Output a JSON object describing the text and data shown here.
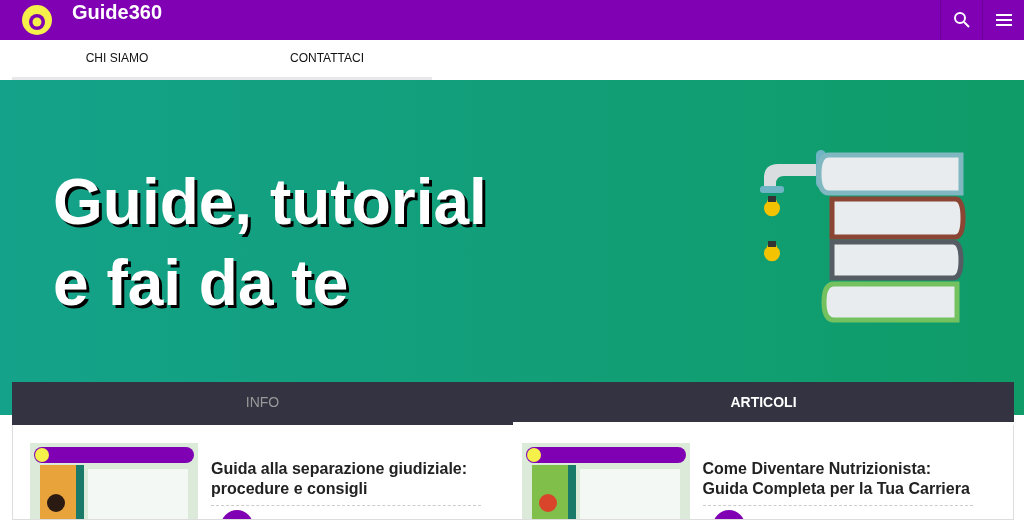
{
  "header": {
    "title": "Guide360"
  },
  "nav": {
    "items": [
      {
        "label": "CHI SIAMO"
      },
      {
        "label": "CONTATTACI"
      }
    ]
  },
  "hero": {
    "lines": [
      "Guide, tutorial",
      "e fai da te"
    ]
  },
  "tabs": [
    {
      "label": "INFO",
      "selected": false
    },
    {
      "label": "ARTICOLI",
      "selected": true
    }
  ],
  "articles": [
    {
      "title": "Guida alla separazione giudiziale: procedure e consigli"
    },
    {
      "title": "Come Diventare Nutrizionista: Guida Completa per la Tua Carriera"
    }
  ]
}
